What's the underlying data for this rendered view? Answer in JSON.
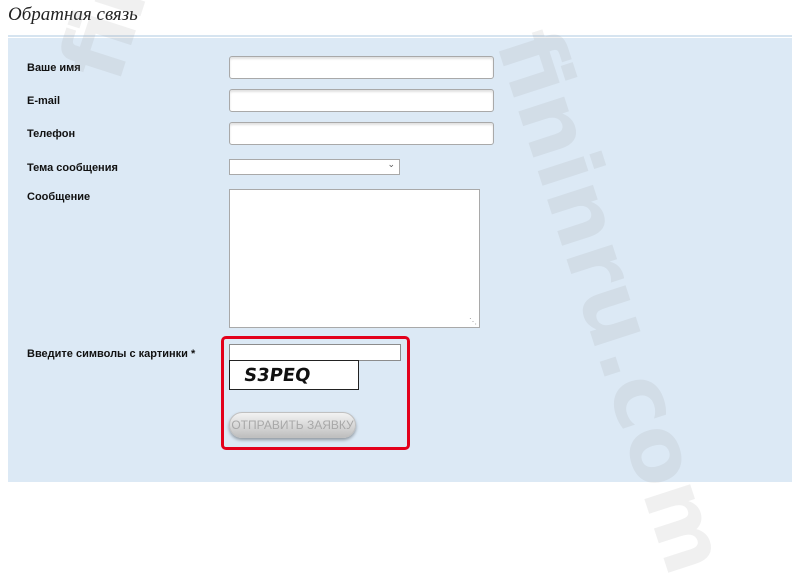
{
  "page": {
    "title": "Обратная связь"
  },
  "form": {
    "name_label": "Ваше имя",
    "email_label": "E-mail",
    "phone_label": "Телефон",
    "subject_label": "Тема сообщения",
    "message_label": "Сообщение",
    "captcha_label": "Введите символы с картинки *",
    "captcha_image_text": "S3PEQ",
    "submit_label": "ОТПРАВИТЬ ЗАЯВКУ"
  },
  "watermark": {
    "text": "fininru.com"
  },
  "colors": {
    "panel_bg": "#dce9f5",
    "highlight": "#e3001b"
  }
}
